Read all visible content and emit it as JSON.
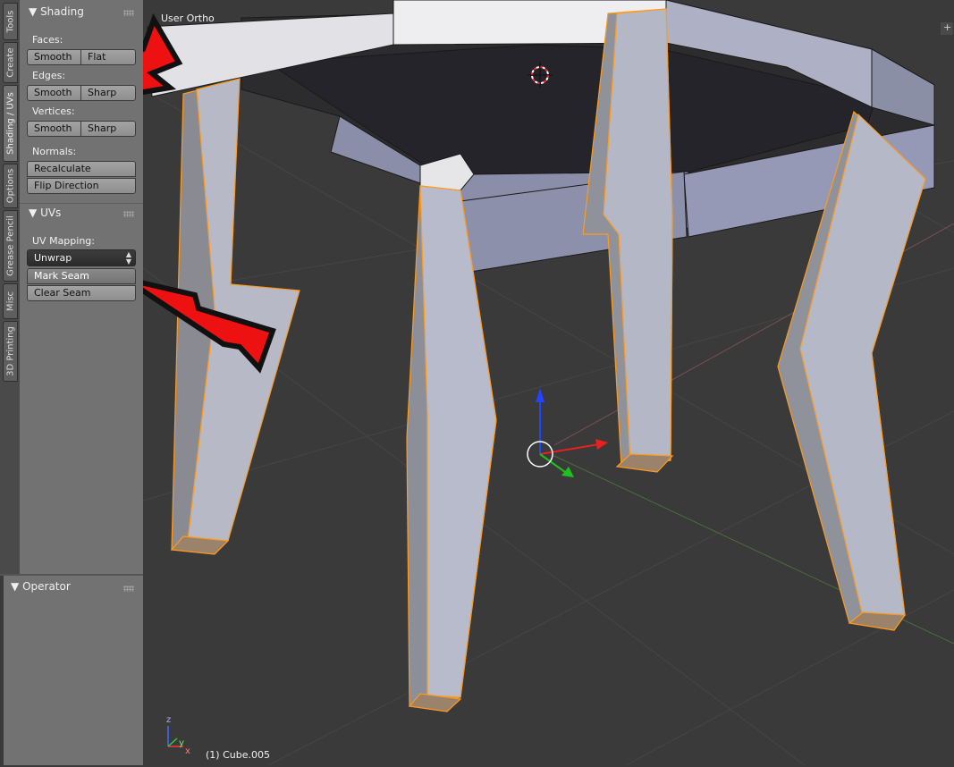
{
  "viewport": {
    "view_label": "User Ortho",
    "object_label": "(1) Cube.005",
    "plus_icon": "+"
  },
  "tabs": [
    {
      "label": "Tools",
      "active": false
    },
    {
      "label": "Create",
      "active": false
    },
    {
      "label": "Shading / UVs",
      "active": true
    },
    {
      "label": "Options",
      "active": false
    },
    {
      "label": "Grease Pencil",
      "active": false
    },
    {
      "label": "Misc",
      "active": false
    },
    {
      "label": "3D Printing",
      "active": false
    }
  ],
  "shading": {
    "title": "Shading",
    "faces_label": "Faces:",
    "faces_smooth": "Smooth",
    "faces_flat": "Flat",
    "edges_label": "Edges:",
    "edges_smooth": "Smooth",
    "edges_sharp": "Sharp",
    "vertices_label": "Vertices:",
    "vertices_smooth": "Smooth",
    "vertices_sharp": "Sharp",
    "normals_label": "Normals:",
    "recalculate": "Recalculate",
    "flip_direction": "Flip Direction"
  },
  "uvs": {
    "title": "UVs",
    "mapping_label": "UV Mapping:",
    "unwrap": "Unwrap",
    "mark_seam": "Mark Seam",
    "clear_seam": "Clear Seam"
  },
  "operator": {
    "title": "Operator"
  },
  "axis_labels": {
    "x": "x",
    "y": "y",
    "z": "z"
  },
  "colors": {
    "selection": "#ff9a1a",
    "arrow_red": "#ee1111",
    "x_axis": "#e82020",
    "y_axis": "#20c020",
    "z_axis": "#2244ff"
  }
}
